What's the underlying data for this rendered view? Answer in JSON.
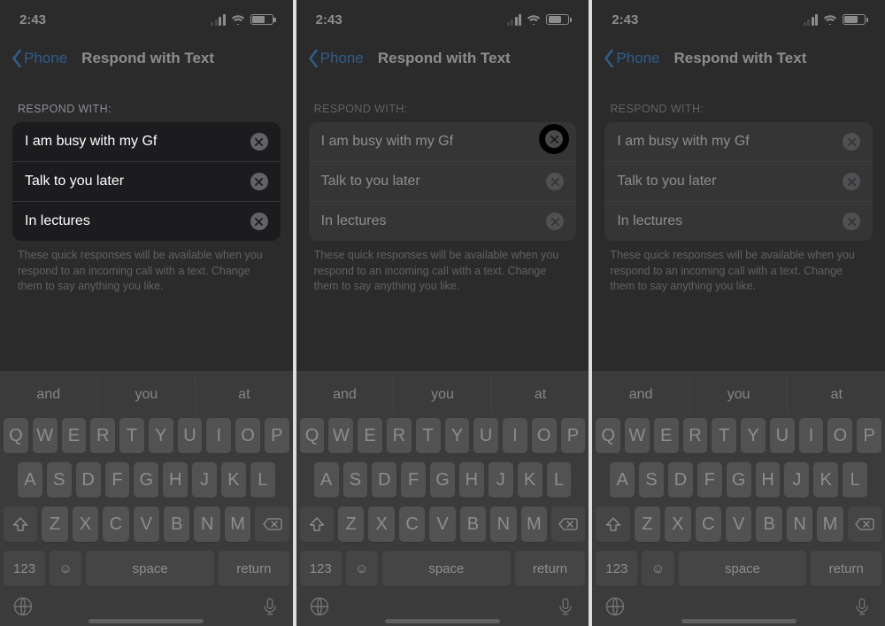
{
  "status": {
    "time": "2:43"
  },
  "nav": {
    "back_label": "Phone",
    "title": "Respond with Text"
  },
  "section_header": "RESPOND WITH:",
  "responses": {
    "r0": "I am busy with my Gf",
    "r1": "Talk to you later",
    "r2": "In lectures"
  },
  "footer_note": "These quick responses will be available when you respond to an incoming call with a text. Change them to say anything you like.",
  "predictive": {
    "p0": "and",
    "p1": "you",
    "p2": "at"
  },
  "keyboard": {
    "row1": [
      "Q",
      "W",
      "E",
      "R",
      "T",
      "Y",
      "U",
      "I",
      "O",
      "P"
    ],
    "row2": [
      "A",
      "S",
      "D",
      "F",
      "G",
      "H",
      "J",
      "K",
      "L"
    ],
    "row3": [
      "Z",
      "X",
      "C",
      "V",
      "B",
      "N",
      "M"
    ],
    "num_label": "123",
    "space_label": "space",
    "return_label": "return"
  }
}
